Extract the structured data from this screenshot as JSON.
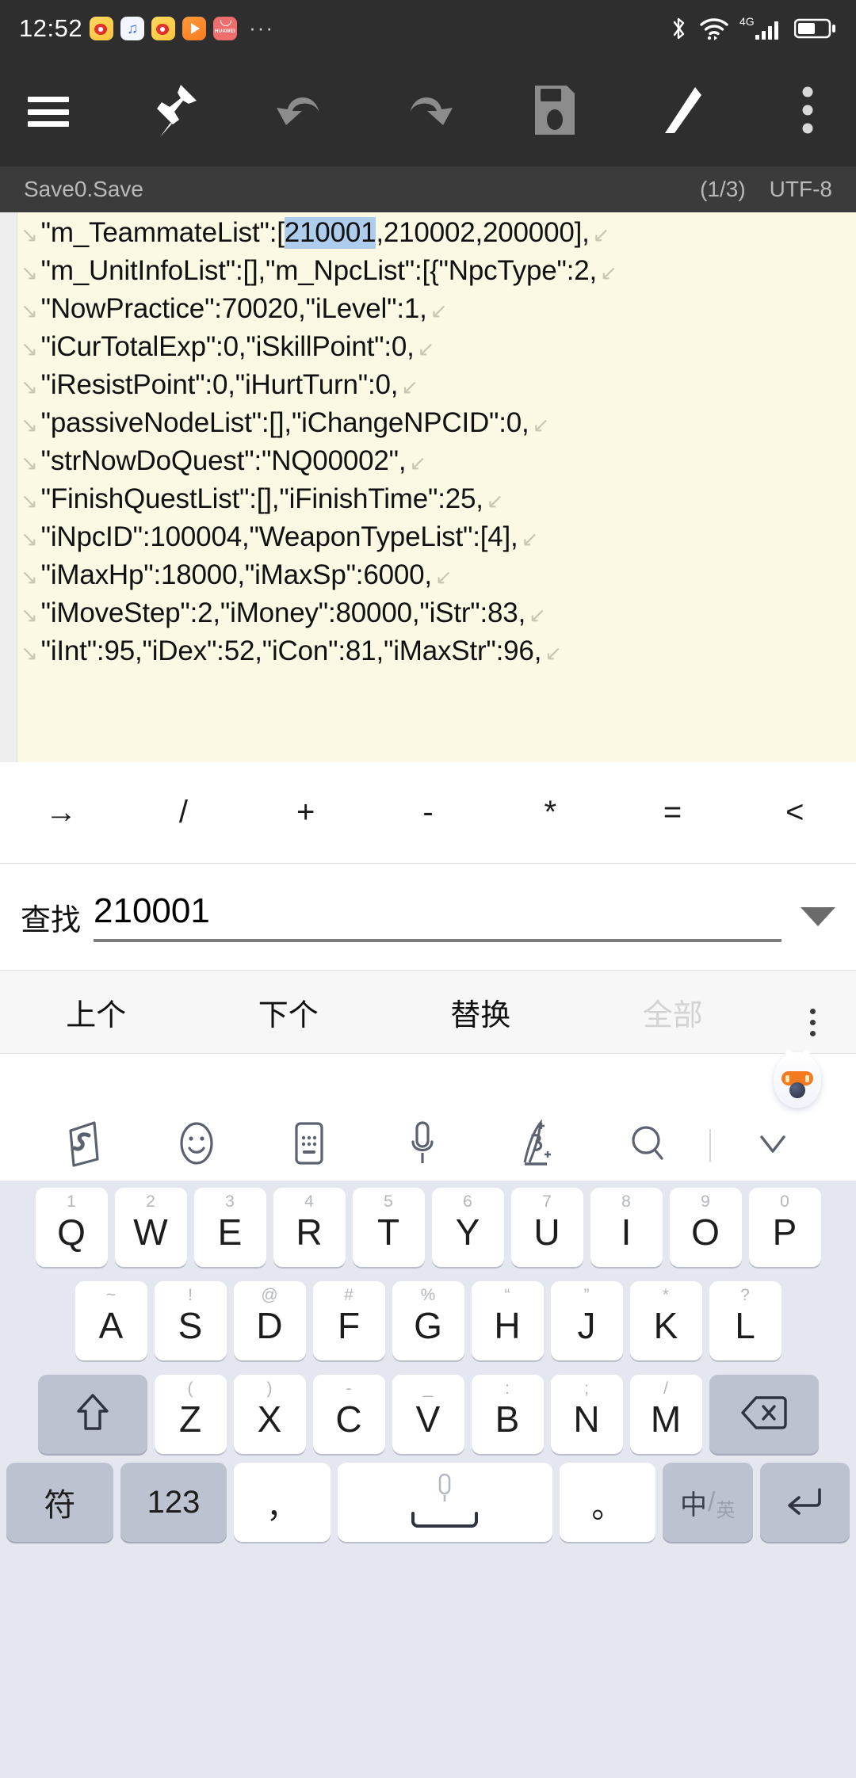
{
  "status_bar": {
    "clock": "12:52",
    "app_icons": [
      "weibo-icon",
      "music-icon",
      "weibo-icon",
      "video-player-icon",
      "huawei-icon"
    ],
    "overflow": "···",
    "network_label": "4G",
    "indicators": [
      "bluetooth-icon",
      "wifi-icon",
      "signal-icon",
      "battery-icon"
    ]
  },
  "toolbar": {
    "menu": "menu-icon",
    "pin": "pin-icon",
    "undo": "undo-icon",
    "redo": "redo-icon",
    "save": "save-icon",
    "edit": "pencil-icon",
    "more": "more-vertical-icon"
  },
  "file_info": {
    "filename": "Save0.Save",
    "page": "(1/3)",
    "encoding": "UTF-8"
  },
  "editor": {
    "wrap_in_glyph": "↘",
    "wrap_out_glyph": "↙",
    "highlight_color": "#aecdec",
    "background": "#fbf8e3",
    "lines": [
      {
        "pre": "\"m_TeammateList\":[",
        "hl": "210001",
        "post": ",210002,200000],"
      },
      {
        "pre": "\"m_UnitInfoList\":[],\"m_NpcList\":[{\"NpcType\":2,",
        "hl": "",
        "post": ""
      },
      {
        "pre": "\"NowPractice\":70020,\"iLevel\":1,",
        "hl": "",
        "post": ""
      },
      {
        "pre": "\"iCurTotalExp\":0,\"iSkillPoint\":0,",
        "hl": "",
        "post": ""
      },
      {
        "pre": "\"iResistPoint\":0,\"iHurtTurn\":0,",
        "hl": "",
        "post": ""
      },
      {
        "pre": "\"passiveNodeList\":[],\"iChangeNPCID\":0,",
        "hl": "",
        "post": ""
      },
      {
        "pre": "\"strNowDoQuest\":\"NQ00002\",",
        "hl": "",
        "post": ""
      },
      {
        "pre": "\"FinishQuestList\":[],\"iFinishTime\":25,",
        "hl": "",
        "post": ""
      },
      {
        "pre": "\"iNpcID\":100004,\"WeaponTypeList\":[4],",
        "hl": "",
        "post": ""
      },
      {
        "pre": "\"iMaxHp\":18000,\"iMaxSp\":6000,",
        "hl": "",
        "post": ""
      },
      {
        "pre": "\"iMoveStep\":2,\"iMoney\":80000,\"iStr\":83,",
        "hl": "",
        "post": ""
      },
      {
        "pre": "\"iInt\":95,\"iDex\":52,\"iCon\":81,\"iMaxStr\":96,",
        "hl": "",
        "post": ""
      }
    ]
  },
  "symbol_bar": {
    "symbols": [
      "→",
      "/",
      "+",
      "-",
      "*",
      "=",
      "<"
    ]
  },
  "find_bar": {
    "label": "查找",
    "value": "210001",
    "placeholder": "",
    "dropdown": "chevron-down-icon"
  },
  "action_bar": {
    "previous": "上个",
    "next": "下个",
    "replace": "替换",
    "all": "全部",
    "all_disabled": true,
    "more": "more-vertical-icon"
  },
  "keyboard": {
    "toolbar_icons": [
      "sogou-logo-icon",
      "emoji-icon",
      "keyboard-icon",
      "microphone-icon",
      "handwriting-icon",
      "search-icon",
      "chevron-down-icon"
    ],
    "mascot": "sogou-mascot-icon",
    "row1": [
      {
        "sup": "1",
        "main": "Q"
      },
      {
        "sup": "2",
        "main": "W"
      },
      {
        "sup": "3",
        "main": "E"
      },
      {
        "sup": "4",
        "main": "R"
      },
      {
        "sup": "5",
        "main": "T"
      },
      {
        "sup": "6",
        "main": "Y"
      },
      {
        "sup": "7",
        "main": "U"
      },
      {
        "sup": "8",
        "main": "I"
      },
      {
        "sup": "9",
        "main": "O"
      },
      {
        "sup": "0",
        "main": "P"
      }
    ],
    "row2": [
      {
        "sup": "~",
        "main": "A"
      },
      {
        "sup": "!",
        "main": "S"
      },
      {
        "sup": "@",
        "main": "D"
      },
      {
        "sup": "#",
        "main": "F"
      },
      {
        "sup": "%",
        "main": "G"
      },
      {
        "sup": "“",
        "main": "H"
      },
      {
        "sup": "”",
        "main": "J"
      },
      {
        "sup": "*",
        "main": "K"
      },
      {
        "sup": "?",
        "main": "L"
      }
    ],
    "row3": [
      {
        "sup": "(",
        "main": "Z"
      },
      {
        "sup": ")",
        "main": "X"
      },
      {
        "sup": "-",
        "main": "C"
      },
      {
        "sup": "_",
        "main": "V"
      },
      {
        "sup": ":",
        "main": "B"
      },
      {
        "sup": ";",
        "main": "N"
      },
      {
        "sup": "/",
        "main": "M"
      }
    ],
    "shift": "shift-icon",
    "backspace": "backspace-icon",
    "row4": {
      "symbols": "符",
      "numbers": "123",
      "comma": "，",
      "space": "space-key",
      "period": "。",
      "lang_zh": "中",
      "lang_slash": "/",
      "lang_en": "英",
      "enter": "enter-icon"
    }
  }
}
